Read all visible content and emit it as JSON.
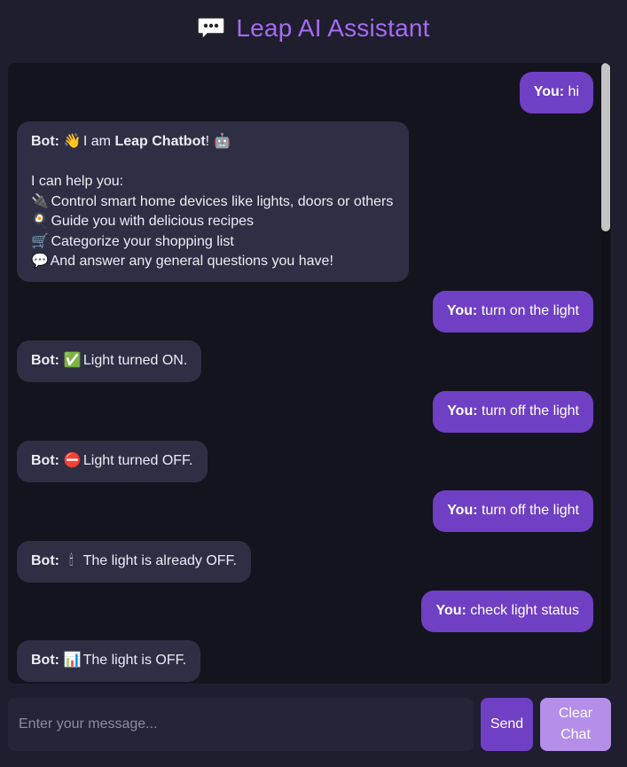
{
  "header": {
    "title": "Leap AI Assistant",
    "icon": "speech-bubble-icon"
  },
  "messages": [
    {
      "role": "user",
      "sender": "You:",
      "text": " hi"
    },
    {
      "role": "bot",
      "sender": "Bot:",
      "emoji": "👋",
      "pre": " I am ",
      "bold": "Leap Chatbot",
      "post": "! 🤖",
      "intro": "I can help you:",
      "lines": [
        {
          "icon": "🔌",
          "text": " Control smart home devices like lights, doors or others"
        },
        {
          "icon": "🍳",
          "text": " Guide you with delicious recipes"
        },
        {
          "icon": "🛒",
          "text": " Categorize your shopping list"
        },
        {
          "icon": "💬",
          "text": " And answer any general questions you have!"
        }
      ]
    },
    {
      "role": "user",
      "sender": "You:",
      "text": " turn on the light"
    },
    {
      "role": "bot",
      "sender": "Bot:",
      "emoji": "✅",
      "text": " Light turned ON."
    },
    {
      "role": "user",
      "sender": "You:",
      "text": " turn off the light"
    },
    {
      "role": "bot",
      "sender": "Bot:",
      "emoji": "⛔",
      "text": " Light turned OFF."
    },
    {
      "role": "user",
      "sender": "You:",
      "text": " turn off the light"
    },
    {
      "role": "bot",
      "sender": "Bot:",
      "emoji": "🕯",
      "text": " The light is already OFF."
    },
    {
      "role": "user",
      "sender": "You:",
      "text": " check light status"
    },
    {
      "role": "bot",
      "sender": "Bot:",
      "emoji": "📊",
      "text": " The light is OFF."
    }
  ],
  "input": {
    "placeholder": "Enter your message..."
  },
  "buttons": {
    "send": "Send",
    "clear": "Clear\nChat"
  },
  "colors": {
    "accent": "#6f3fc4",
    "title": "#a66bf0",
    "bot_bubble": "#2e2f45",
    "background": "#1e1e2e"
  }
}
